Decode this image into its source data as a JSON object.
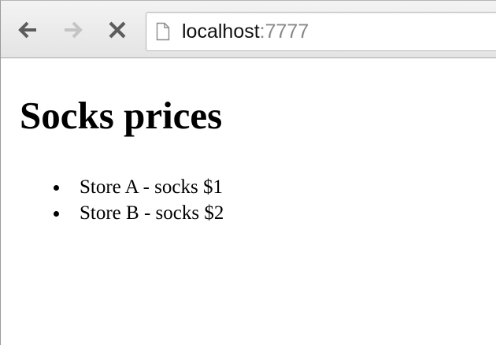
{
  "browser": {
    "back_icon": "arrow-left-icon",
    "forward_icon": "arrow-right-icon",
    "stop_icon": "close-icon",
    "page_icon": "page-icon",
    "address": {
      "host": "localhost",
      "port": ":7777"
    }
  },
  "page": {
    "title": "Socks prices",
    "items": [
      "Store A - socks $1",
      "Store B - socks $2"
    ]
  },
  "colors": {
    "toolbar": "#eaeaea",
    "icon_active": "#5c5c5c",
    "icon_disabled": "#c4c4c4",
    "text": "#000000"
  }
}
